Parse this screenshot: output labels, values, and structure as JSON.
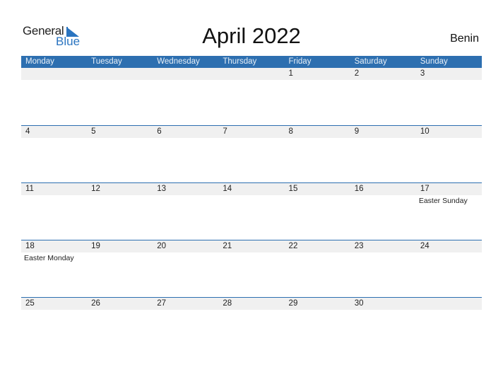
{
  "logo": {
    "general": "General",
    "blue": "Blue",
    "icon": "triangle-flag-icon"
  },
  "title": "April 2022",
  "country": "Benin",
  "colors": {
    "accent": "#2d6fb0",
    "row_fill": "#f0f0f0",
    "logo_blue": "#2a74c0"
  },
  "weekdays": [
    "Monday",
    "Tuesday",
    "Wednesday",
    "Thursday",
    "Friday",
    "Saturday",
    "Sunday"
  ],
  "weeks": [
    [
      {
        "day": ""
      },
      {
        "day": ""
      },
      {
        "day": ""
      },
      {
        "day": ""
      },
      {
        "day": "1"
      },
      {
        "day": "2"
      },
      {
        "day": "3"
      }
    ],
    [
      {
        "day": "4"
      },
      {
        "day": "5"
      },
      {
        "day": "6"
      },
      {
        "day": "7"
      },
      {
        "day": "8"
      },
      {
        "day": "9"
      },
      {
        "day": "10"
      }
    ],
    [
      {
        "day": "11"
      },
      {
        "day": "12"
      },
      {
        "day": "13"
      },
      {
        "day": "14"
      },
      {
        "day": "15"
      },
      {
        "day": "16"
      },
      {
        "day": "17",
        "holiday": "Easter Sunday"
      }
    ],
    [
      {
        "day": "18",
        "holiday": "Easter Monday"
      },
      {
        "day": "19"
      },
      {
        "day": "20"
      },
      {
        "day": "21"
      },
      {
        "day": "22"
      },
      {
        "day": "23"
      },
      {
        "day": "24"
      }
    ],
    [
      {
        "day": "25"
      },
      {
        "day": "26"
      },
      {
        "day": "27"
      },
      {
        "day": "28"
      },
      {
        "day": "29"
      },
      {
        "day": "30"
      },
      {
        "day": ""
      }
    ]
  ]
}
